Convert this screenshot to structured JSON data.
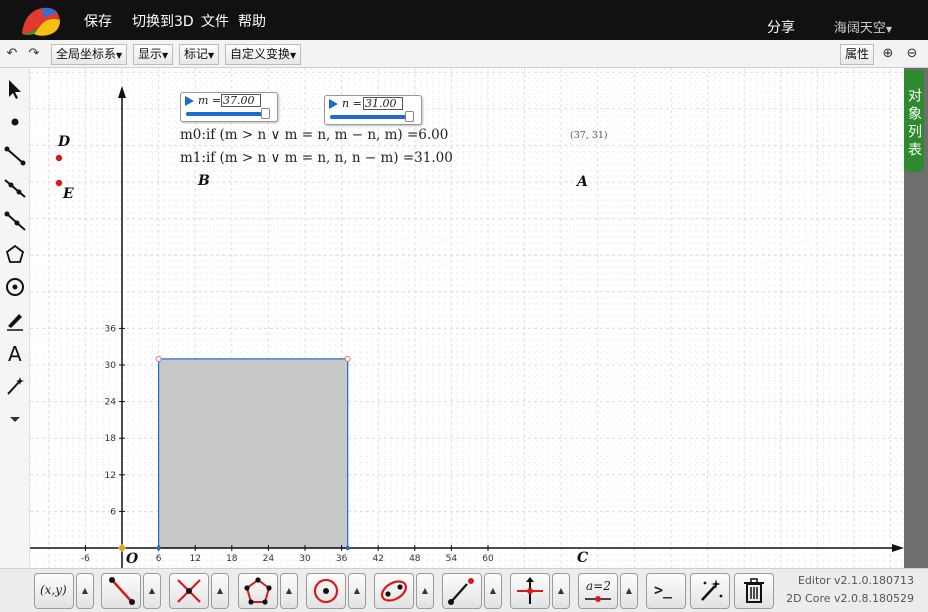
{
  "topbar": {
    "menu": [
      "保存",
      "切换到3D",
      "文件",
      "帮助"
    ],
    "share": "分享",
    "user": "海阔天空"
  },
  "toolbar": {
    "undo_icon": "undo-icon",
    "redo_icon": "redo-icon",
    "coord_system": "全局坐标系",
    "display": "显示",
    "mark": "标记",
    "transform": "自定义变换",
    "properties": "属性",
    "zoom_in_icon": "zoom-in-icon",
    "zoom_out_icon": "zoom-out-icon"
  },
  "right_panel": {
    "tab": "对象列表"
  },
  "sliders": {
    "m": {
      "label": "m =",
      "value": "37.00",
      "fraction": 0.96
    },
    "n": {
      "label": "n =",
      "value": "31.00",
      "fraction": 0.96
    }
  },
  "formulas": {
    "m0": "m0:if (m > n ∨ m = n, m − n, m) =6.00",
    "m1": "m1:if (m > n ∨ m = n, n, n − m) =31.00"
  },
  "points": {
    "A": "A",
    "B": "B",
    "C": "C",
    "D": "D",
    "E": "E",
    "O": "O",
    "coord_A": "(37, 31)"
  },
  "axes": {
    "x_ticks": [
      "-6",
      "6",
      "12",
      "18",
      "24",
      "30",
      "36",
      "42",
      "48",
      "54",
      "60"
    ],
    "y_ticks": [
      "6",
      "12",
      "18",
      "24",
      "30",
      "36"
    ]
  },
  "colors": {
    "accent": "#1d6ad0",
    "rect_fill": "#c8c8c8",
    "rect_stroke": "#1d6ad0",
    "point_red": "#d91a1a",
    "tab_green": "#2e8a2e"
  },
  "bottom": {
    "tools": [
      "coordinate-input-icon",
      "segment-icon",
      "intersect-icon",
      "polygon-icon",
      "circle-icon",
      "conic-icon",
      "ray-icon",
      "transform-icon",
      "slider-icon",
      "command-icon",
      "magic-icon",
      "trash-icon"
    ],
    "coord_label": "(x,y)",
    "slider_label": "a=2",
    "command_label": ">_",
    "editor_version": "Editor v2.1.0.180713",
    "core_version": "2D Core v2.0.8.180529"
  }
}
